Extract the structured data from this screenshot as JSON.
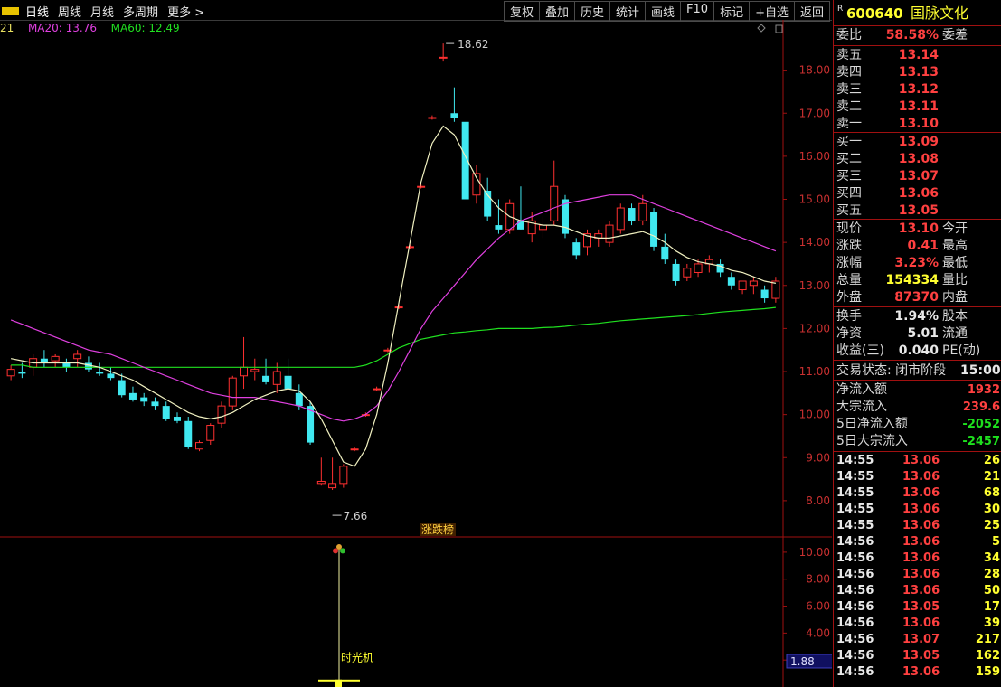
{
  "toolbar": {
    "tabs": [
      "日线",
      "周线",
      "月线",
      "多周期",
      "更多 >"
    ],
    "buttons": [
      "复权",
      "叠加",
      "历史",
      "统计",
      "画线",
      "F10",
      "标记",
      "+自选",
      "返回"
    ]
  },
  "ma_legend": {
    "ma_short": "21",
    "ma20": "MA20: 13.76",
    "ma60": "MA60: 12.49",
    "colors": {
      "ma_short": "#e8e060",
      "ma20": "#e040e0",
      "ma60": "#20e020"
    }
  },
  "chart_annotations": {
    "high_label": "18.62",
    "low_label": "7.66",
    "mid_tag": "涨跌榜",
    "sub_label": "时光机",
    "sub_value": "1.88"
  },
  "chart_data": {
    "type": "candlestick",
    "price_ylim": [
      7.2,
      19.0
    ],
    "price_ticks": [
      "18.00",
      "17.00",
      "16.00",
      "15.00",
      "14.00",
      "13.00",
      "12.00",
      "11.00",
      "10.00",
      "9.00",
      "8.00"
    ],
    "sub_ylim": [
      0,
      11
    ],
    "sub_ticks": [
      "10.00",
      "8.00",
      "6.00",
      "4.00",
      "2.00"
    ],
    "candles": [
      [
        10.9,
        11.15,
        10.8,
        11.05
      ],
      [
        11.0,
        11.2,
        10.85,
        10.95
      ],
      [
        11.1,
        11.4,
        10.9,
        11.3
      ],
      [
        11.3,
        11.5,
        11.1,
        11.2
      ],
      [
        11.25,
        11.4,
        11.1,
        11.35
      ],
      [
        11.2,
        11.3,
        11.0,
        11.1
      ],
      [
        11.3,
        11.5,
        11.1,
        11.4
      ],
      [
        11.2,
        11.35,
        11.0,
        11.05
      ],
      [
        11.0,
        11.2,
        10.9,
        10.95
      ],
      [
        10.95,
        11.1,
        10.8,
        10.85
      ],
      [
        10.8,
        10.95,
        10.4,
        10.45
      ],
      [
        10.5,
        10.65,
        10.3,
        10.35
      ],
      [
        10.4,
        10.5,
        10.2,
        10.3
      ],
      [
        10.3,
        10.4,
        10.1,
        10.2
      ],
      [
        10.2,
        10.3,
        9.85,
        9.9
      ],
      [
        9.95,
        10.05,
        9.8,
        9.85
      ],
      [
        9.85,
        9.95,
        9.2,
        9.25
      ],
      [
        9.2,
        9.4,
        9.15,
        9.35
      ],
      [
        9.4,
        9.8,
        9.3,
        9.75
      ],
      [
        9.8,
        10.3,
        9.7,
        10.2
      ],
      [
        10.2,
        10.9,
        10.1,
        10.85
      ],
      [
        10.9,
        11.8,
        10.6,
        11.1
      ],
      [
        11.0,
        11.3,
        10.8,
        11.05
      ],
      [
        10.9,
        11.3,
        10.7,
        10.75
      ],
      [
        10.7,
        11.2,
        10.5,
        11.0
      ],
      [
        10.9,
        11.3,
        10.7,
        10.6
      ],
      [
        10.5,
        10.7,
        10.1,
        10.2
      ],
      [
        10.2,
        10.3,
        9.3,
        9.35
      ],
      [
        8.4,
        9.0,
        8.35,
        8.45
      ],
      [
        8.3,
        9.0,
        8.25,
        8.4
      ],
      [
        8.4,
        8.85,
        8.3,
        8.8
      ],
      [
        9.2,
        9.25,
        9.15,
        9.2
      ],
      [
        10.0,
        10.05,
        9.95,
        10.0
      ],
      [
        10.6,
        10.65,
        10.55,
        10.6
      ],
      [
        11.5,
        11.55,
        11.45,
        11.5
      ],
      [
        12.5,
        12.55,
        12.45,
        12.5
      ],
      [
        13.9,
        13.95,
        13.85,
        13.9
      ],
      [
        15.3,
        15.35,
        15.25,
        15.3
      ],
      [
        16.9,
        16.95,
        16.85,
        16.9
      ],
      [
        18.3,
        18.62,
        18.2,
        18.3
      ],
      [
        17.0,
        17.6,
        16.8,
        16.9
      ],
      [
        16.8,
        16.0,
        15.1,
        15.0
      ],
      [
        15.1,
        15.8,
        14.9,
        15.6
      ],
      [
        15.2,
        15.5,
        14.5,
        14.6
      ],
      [
        14.4,
        15.0,
        14.2,
        14.3
      ],
      [
        14.3,
        15.0,
        14.2,
        14.9
      ],
      [
        14.5,
        15.3,
        14.3,
        14.3
      ],
      [
        14.2,
        14.7,
        14.0,
        14.5
      ],
      [
        14.3,
        14.6,
        14.1,
        14.4
      ],
      [
        14.5,
        15.9,
        14.4,
        15.3
      ],
      [
        15.0,
        15.1,
        14.1,
        14.2
      ],
      [
        14.0,
        14.1,
        13.6,
        13.7
      ],
      [
        13.9,
        14.3,
        13.7,
        14.2
      ],
      [
        14.1,
        14.3,
        13.9,
        14.2
      ],
      [
        14.0,
        14.5,
        13.9,
        14.4
      ],
      [
        14.3,
        14.9,
        14.2,
        14.8
      ],
      [
        14.8,
        14.9,
        14.4,
        14.5
      ],
      [
        14.5,
        15.1,
        14.4,
        14.9
      ],
      [
        14.7,
        14.8,
        13.8,
        13.9
      ],
      [
        13.9,
        14.2,
        13.5,
        13.6
      ],
      [
        13.5,
        13.6,
        13.0,
        13.1
      ],
      [
        13.2,
        13.5,
        13.1,
        13.4
      ],
      [
        13.3,
        13.6,
        13.2,
        13.5
      ],
      [
        13.5,
        13.7,
        13.3,
        13.6
      ],
      [
        13.5,
        13.6,
        13.2,
        13.3
      ],
      [
        13.2,
        13.3,
        12.9,
        13.0
      ],
      [
        12.9,
        13.1,
        12.8,
        13.1
      ],
      [
        13.0,
        13.2,
        12.8,
        13.1
      ],
      [
        12.9,
        13.0,
        12.6,
        12.7
      ],
      [
        12.7,
        13.2,
        12.6,
        13.1
      ]
    ],
    "ma_short": [
      11.3,
      11.25,
      11.2,
      11.2,
      11.2,
      11.2,
      11.2,
      11.15,
      11.1,
      11.0,
      10.9,
      10.8,
      10.65,
      10.5,
      10.35,
      10.2,
      10.05,
      9.95,
      9.9,
      9.95,
      10.05,
      10.2,
      10.35,
      10.45,
      10.55,
      10.6,
      10.55,
      10.3,
      9.9,
      9.4,
      8.9,
      8.8,
      9.2,
      10.0,
      11.2,
      12.6,
      14.0,
      15.4,
      16.3,
      16.7,
      16.5,
      16.0,
      15.5,
      15.1,
      14.8,
      14.6,
      14.5,
      14.45,
      14.4,
      14.4,
      14.35,
      14.25,
      14.15,
      14.1,
      14.1,
      14.15,
      14.2,
      14.25,
      14.15,
      14.0,
      13.8,
      13.65,
      13.55,
      13.5,
      13.45,
      13.35,
      13.3,
      13.2,
      13.1,
      13.05
    ],
    "ma20": [
      12.2,
      12.1,
      12.0,
      11.9,
      11.8,
      11.7,
      11.6,
      11.5,
      11.45,
      11.4,
      11.3,
      11.2,
      11.1,
      11.0,
      10.9,
      10.8,
      10.7,
      10.6,
      10.5,
      10.45,
      10.4,
      10.4,
      10.4,
      10.35,
      10.3,
      10.25,
      10.2,
      10.1,
      10.0,
      9.9,
      9.85,
      9.9,
      10.0,
      10.2,
      10.55,
      11.0,
      11.5,
      12.0,
      12.4,
      12.7,
      13.0,
      13.3,
      13.6,
      13.85,
      14.1,
      14.3,
      14.5,
      14.6,
      14.7,
      14.8,
      14.9,
      14.95,
      15.0,
      15.05,
      15.1,
      15.1,
      15.1,
      15.0,
      14.9,
      14.8,
      14.7,
      14.6,
      14.5,
      14.4,
      14.3,
      14.2,
      14.1,
      14.0,
      13.9,
      13.8
    ],
    "ma60": [
      11.15,
      11.15,
      11.1,
      11.1,
      11.1,
      11.1,
      11.1,
      11.1,
      11.1,
      11.1,
      11.1,
      11.1,
      11.1,
      11.1,
      11.1,
      11.1,
      11.1,
      11.1,
      11.1,
      11.1,
      11.1,
      11.1,
      11.1,
      11.1,
      11.1,
      11.1,
      11.1,
      11.1,
      11.1,
      11.1,
      11.1,
      11.1,
      11.15,
      11.25,
      11.4,
      11.55,
      11.65,
      11.75,
      11.8,
      11.85,
      11.9,
      11.92,
      11.95,
      11.97,
      12.0,
      12.0,
      12.0,
      12.0,
      12.02,
      12.03,
      12.05,
      12.08,
      12.1,
      12.12,
      12.15,
      12.18,
      12.2,
      12.22,
      12.24,
      12.26,
      12.28,
      12.3,
      12.32,
      12.35,
      12.38,
      12.4,
      12.42,
      12.44,
      12.46,
      12.49
    ]
  },
  "quote": {
    "code": "600640",
    "name": "国脉文化",
    "weibi_label": "委比",
    "weibi_value": "58.58%",
    "weicha_label": "委差",
    "sells": [
      {
        "label": "卖五",
        "price": "13.14"
      },
      {
        "label": "卖四",
        "price": "13.13"
      },
      {
        "label": "卖三",
        "price": "13.12"
      },
      {
        "label": "卖二",
        "price": "13.11"
      },
      {
        "label": "卖一",
        "price": "13.10"
      }
    ],
    "buys": [
      {
        "label": "买一",
        "price": "13.09"
      },
      {
        "label": "买二",
        "price": "13.08"
      },
      {
        "label": "买三",
        "price": "13.07"
      },
      {
        "label": "买四",
        "price": "13.06"
      },
      {
        "label": "买五",
        "price": "13.05"
      }
    ],
    "stats1": [
      {
        "label": "现价",
        "value": "13.10",
        "right": "今开",
        "color": "red"
      },
      {
        "label": "涨跌",
        "value": "0.41",
        "right": "最高",
        "color": "red"
      },
      {
        "label": "涨幅",
        "value": "3.23%",
        "right": "最低",
        "color": "red"
      },
      {
        "label": "总量",
        "value": "154334",
        "right": "量比",
        "color": "yellow"
      },
      {
        "label": "外盘",
        "value": "87370",
        "right": "内盘",
        "color": "red"
      }
    ],
    "stats2": [
      {
        "label": "换手",
        "value": "1.94%",
        "right": "股本"
      },
      {
        "label": "净资",
        "value": "5.01",
        "right": "流通"
      },
      {
        "label": "收益(三)",
        "value": "0.040",
        "right": "PE(动)"
      }
    ],
    "trade_status_label": "交易状态: 闭市阶段",
    "trade_time": "15:00:0",
    "flows": [
      {
        "label": "净流入额",
        "value": "1932",
        "color": "red"
      },
      {
        "label": "大宗流入",
        "value": "239.6",
        "color": "red"
      },
      {
        "label": "5日净流入额",
        "value": "-2052",
        "color": "green"
      },
      {
        "label": "5日大宗流入",
        "value": "-2457",
        "color": "green"
      }
    ],
    "ticks": [
      {
        "time": "14:55",
        "price": "13.06",
        "vol": "26"
      },
      {
        "time": "14:55",
        "price": "13.06",
        "vol": "21"
      },
      {
        "time": "14:55",
        "price": "13.06",
        "vol": "68"
      },
      {
        "time": "14:55",
        "price": "13.06",
        "vol": "30"
      },
      {
        "time": "14:55",
        "price": "13.06",
        "vol": "25"
      },
      {
        "time": "14:56",
        "price": "13.06",
        "vol": "5"
      },
      {
        "time": "14:56",
        "price": "13.06",
        "vol": "34"
      },
      {
        "time": "14:56",
        "price": "13.06",
        "vol": "28"
      },
      {
        "time": "14:56",
        "price": "13.06",
        "vol": "50"
      },
      {
        "time": "14:56",
        "price": "13.05",
        "vol": "17"
      },
      {
        "time": "14:56",
        "price": "13.06",
        "vol": "39"
      },
      {
        "time": "14:56",
        "price": "13.07",
        "vol": "217"
      },
      {
        "time": "14:56",
        "price": "13.05",
        "vol": "162"
      },
      {
        "time": "14:56",
        "price": "13.06",
        "vol": "159"
      }
    ]
  }
}
